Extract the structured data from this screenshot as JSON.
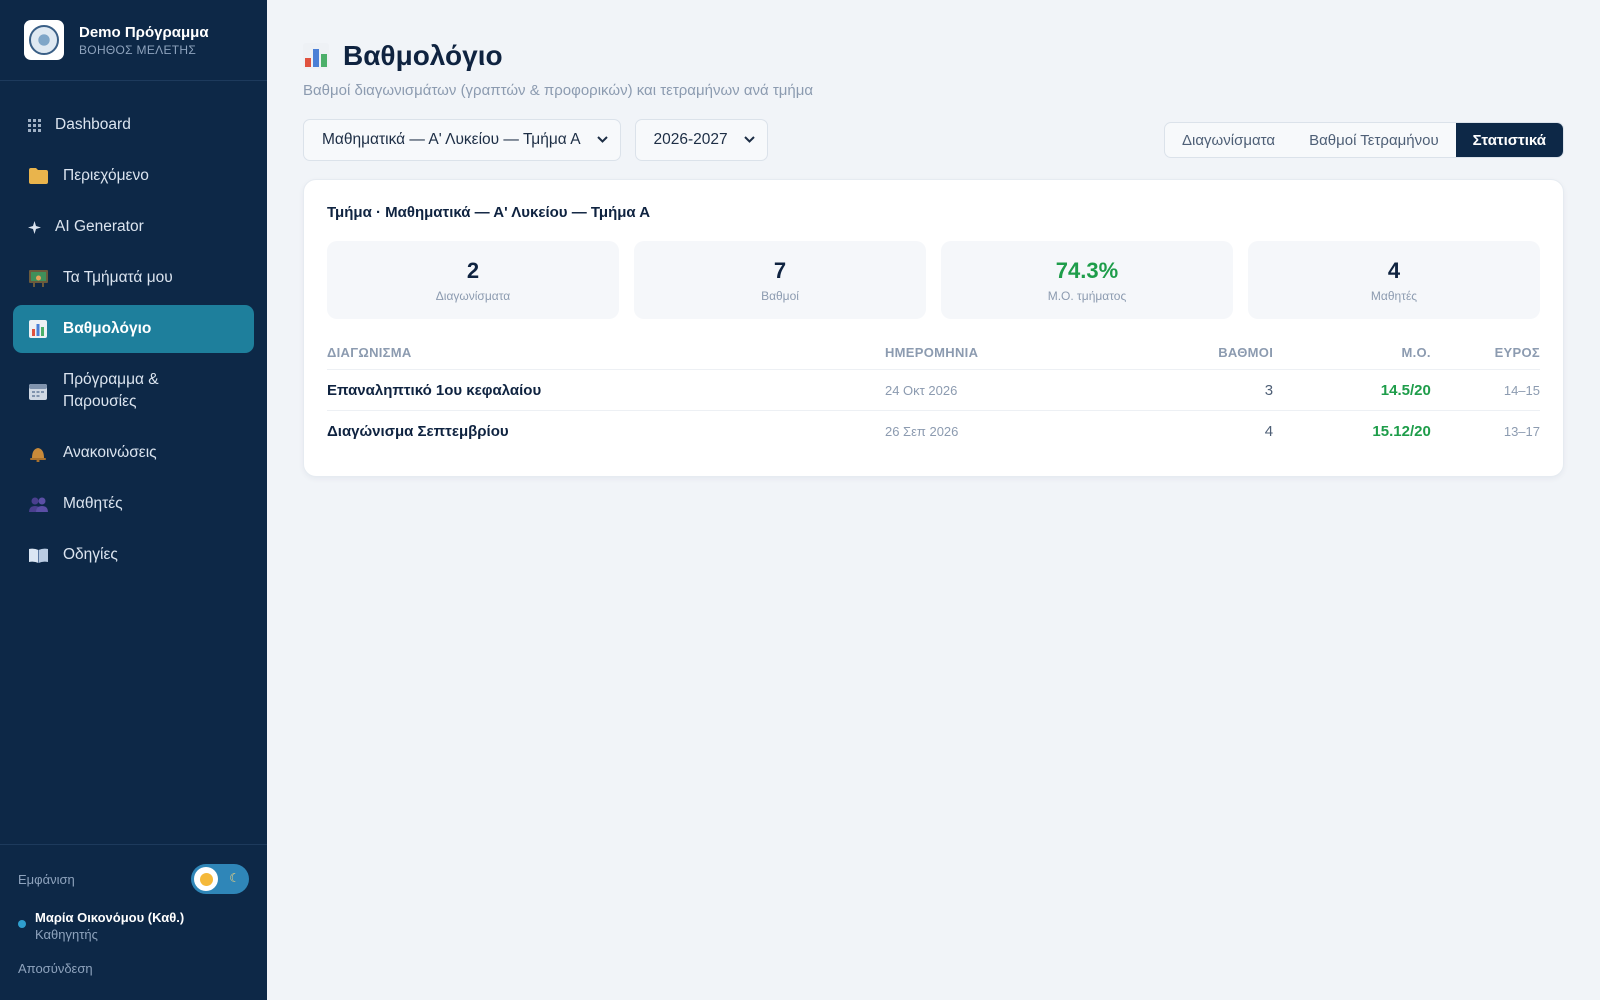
{
  "brand": {
    "title": "Demo Πρόγραμμα",
    "subtitle": "ΒΟΗΘΟΣ ΜΕΛΕΤΗΣ"
  },
  "sidebar": {
    "items": [
      {
        "label": "Dashboard",
        "icon": "grid-icon"
      },
      {
        "label": "Περιεχόμενο",
        "icon": "folder-icon"
      },
      {
        "label": "AI Generator",
        "icon": "sparkle-icon"
      },
      {
        "label": "Τα Τμήματά μου",
        "icon": "classroom-icon"
      },
      {
        "label": "Βαθμολόγιο",
        "icon": "bar-chart-icon",
        "active": true
      },
      {
        "label": "Πρόγραμμα & Παρουσίες",
        "icon": "calendar-icon"
      },
      {
        "label": "Ανακοινώσεις",
        "icon": "bell-icon"
      },
      {
        "label": "Μαθητές",
        "icon": "users-icon"
      },
      {
        "label": "Οδηγίες",
        "icon": "book-icon"
      }
    ],
    "appearance_label": "Εμφάνιση",
    "user": {
      "name": "Μαρία Οικονόμου (Καθ.)",
      "role": "Καθηγητής"
    },
    "logout": "Αποσύνδεση"
  },
  "header": {
    "title": "Βαθμολόγιο",
    "subtitle": "Βαθμοί διαγωνισμάτων (γραπτών & προφορικών) και τετραμήνων ανά τμήμα"
  },
  "filters": {
    "class_select": "Μαθηματικά — Α' Λυκείου — Τμήμα Α",
    "year_select": "2026-2027"
  },
  "tabs": [
    {
      "label": "Διαγωνίσματα"
    },
    {
      "label": "Βαθμοί Τετραμήνου"
    },
    {
      "label": "Στατιστικά",
      "active": true
    }
  ],
  "card": {
    "title": "Τμήμα · Μαθηματικά — Α' Λυκείου — Τμήμα Α",
    "stats": [
      {
        "value": "2",
        "label": "Διαγωνίσματα"
      },
      {
        "value": "7",
        "label": "Βαθμοί"
      },
      {
        "value": "74.3%",
        "label": "Μ.Ο. τμήματος"
      },
      {
        "value": "4",
        "label": "Μαθητές"
      }
    ],
    "table": {
      "headers": [
        "ΔΙΑΓΩΝΙΣΜΑ",
        "ΗΜΕΡΟΜΗΝΙΑ",
        "ΒΑΘΜΟΙ",
        "Μ.Ο.",
        "ΕΥΡΟΣ"
      ],
      "rows": [
        {
          "name": "Επαναληπτικό 1ου κεφαλαίου",
          "date": "24 Οκτ 2026",
          "grades": "3",
          "avg": "14.5/20",
          "range": "14–15"
        },
        {
          "name": "Διαγώνισμα Σεπτεμβρίου",
          "date": "26 Σεπ 2026",
          "grades": "4",
          "avg": "15.12/20",
          "range": "13–17"
        }
      ]
    }
  },
  "colors": {
    "sidebar": "#0d2847",
    "active_nav": "#1e7f9c",
    "accent_green": "#1e9d4a"
  }
}
